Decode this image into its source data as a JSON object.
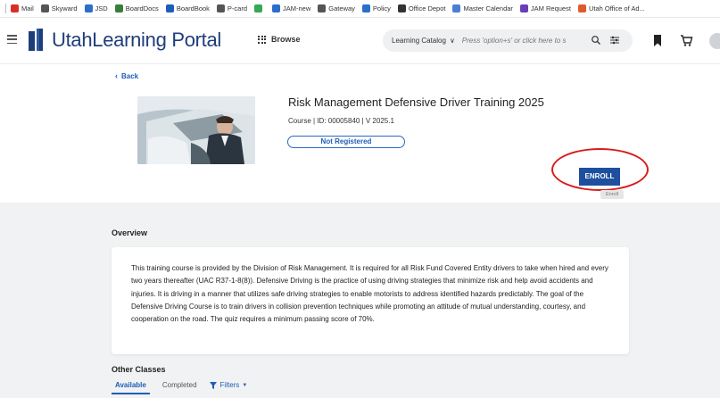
{
  "bookmarks": [
    {
      "label": "Mail",
      "icon": "gmail-icon",
      "color": "#d93025"
    },
    {
      "label": "Skyward",
      "icon": "globe-icon",
      "color": "#555555"
    },
    {
      "label": "JSD",
      "icon": "shield-icon",
      "color": "#2a6fc9"
    },
    {
      "label": "BoardDocs",
      "icon": "boarddocs-icon",
      "color": "#3a7d3a"
    },
    {
      "label": "BoardBook",
      "icon": "boardbook-icon",
      "color": "#1f5db8"
    },
    {
      "label": "P-card",
      "icon": "globe-icon",
      "color": "#555555"
    },
    {
      "label": "",
      "icon": "drive-icon",
      "color": "#34a853"
    },
    {
      "label": "JAM-new",
      "icon": "shield-icon",
      "color": "#2a6fc9"
    },
    {
      "label": "Gateway",
      "icon": "globe-icon",
      "color": "#555555"
    },
    {
      "label": "Policy",
      "icon": "policy-icon",
      "color": "#2a6fc9"
    },
    {
      "label": "Office Depot",
      "icon": "office-depot-icon",
      "color": "#333333"
    },
    {
      "label": "Master Calendar",
      "icon": "calendar-icon",
      "color": "#4a7fd1"
    },
    {
      "label": "JAM Request",
      "icon": "form-icon",
      "color": "#6a3fb5"
    },
    {
      "label": "Utah Office of Ad...",
      "icon": "utah-office-icon",
      "color": "#e25a2c"
    }
  ],
  "header": {
    "brand_light": "Utah",
    "brand_main": "Learning",
    "brand_light2": " Portal",
    "browse_label": "Browse",
    "catalog_label": "Learning Catalog",
    "search_placeholder": "Press 'option+s' or click here to s"
  },
  "course": {
    "back_label": "Back",
    "title": "Risk Management Defensive Driver Training 2025",
    "meta": "Course  |  ID: 00005840  |   V 2025.1",
    "status": "Not Registered",
    "enroll_label": "ENROLL",
    "tooltip": "Enroll"
  },
  "overview": {
    "heading": "Overview",
    "text": "This training course is provided by the Division of Risk Management. It is required for all Risk Fund Covered Entity drivers to take when hired and every two years thereafter (UAC R37-1-8(8)). Defensive Driving is the practice of using driving strategies that minimize risk and help avoid accidents and injuries. It is driving in a manner that utilizes safe driving strategies to enable motorists to address identified hazards predictably. The goal of the Defensive Driving Course is to train drivers in collision prevention techniques while promoting an attitude of mutual understanding, courtesy, and cooperation on the road. The quiz requires a minimum passing score of 70%."
  },
  "other_classes": {
    "heading": "Other Classes",
    "tabs": [
      "Available",
      "Completed"
    ],
    "filters_label": "Filters"
  },
  "colors": {
    "brand": "#1f3d7a",
    "link": "#1f5db8",
    "enroll": "#1e4f9e",
    "annotation": "#d91c1c"
  }
}
